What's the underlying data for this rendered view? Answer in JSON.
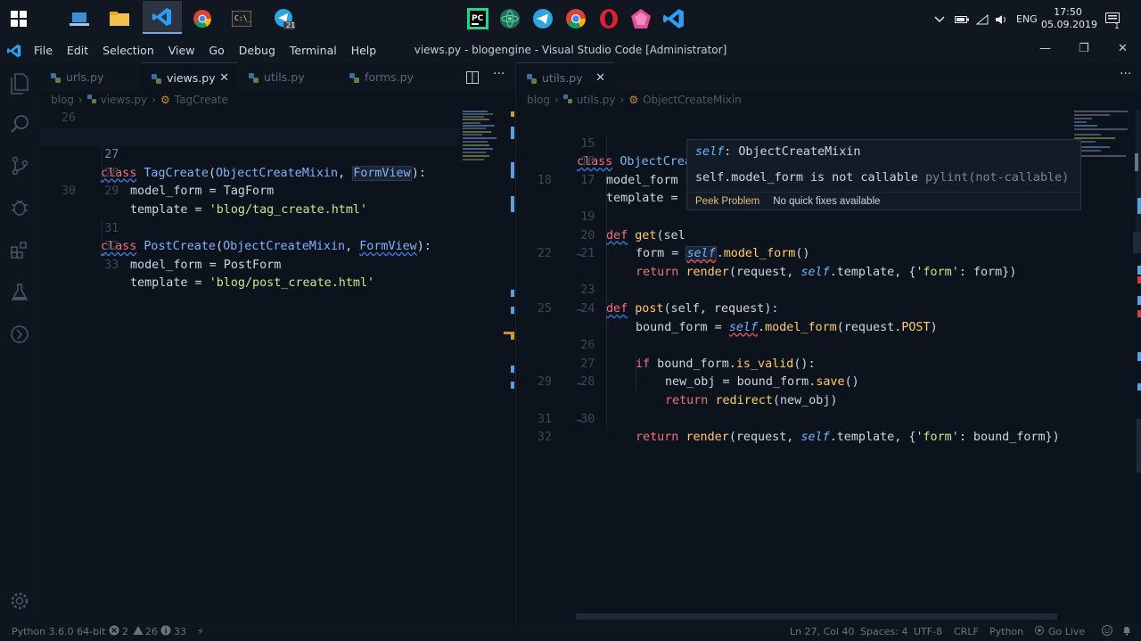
{
  "taskbar": {
    "lang": "ENG",
    "time": "17:50",
    "date": "05.09.2019",
    "telegram_badge": "21",
    "notif_badge": "1"
  },
  "window": {
    "title": "views.py - blogengine - Visual Studio Code [Administrator]",
    "menu": [
      "File",
      "Edit",
      "Selection",
      "View",
      "Go",
      "Debug",
      "Terminal",
      "Help"
    ]
  },
  "left_editor": {
    "tabs": [
      {
        "label": "urls.py",
        "active": false
      },
      {
        "label": "views.py",
        "active": true
      },
      {
        "label": "utils.py",
        "active": false
      },
      {
        "label": "forms.py",
        "active": false
      }
    ],
    "breadcrumb": [
      "blog",
      "views.py",
      "TagCreate"
    ],
    "lines": [
      {
        "n": "26"
      },
      {
        "n": "27"
      },
      {
        "n": "28"
      },
      {
        "n": "29"
      },
      {
        "n": "30"
      },
      {
        "n": "31"
      },
      {
        "n": "32"
      },
      {
        "n": "33"
      }
    ],
    "code": {
      "l27a": "class",
      "l27b": "TagCreate",
      "l27c": "(",
      "l27d": "ObjectCreateMixin",
      "l27e": ", ",
      "l27f": "FormView",
      "l27g": "):",
      "l28": "model_form = TagForm",
      "l29a": "template = ",
      "l29b": "'blog/tag_create.html'",
      "l31a": "class",
      "l31b": "PostCreate",
      "l31c": "(",
      "l31d": "ObjectCreateMixin",
      "l31e": ", ",
      "l31f": "FormView",
      "l31g": "):",
      "l32": "model_form = PostForm",
      "l33a": "template = ",
      "l33b": "'blog/post_create.html'"
    }
  },
  "right_editor": {
    "tabs": [
      {
        "label": "utils.py",
        "active": true
      }
    ],
    "breadcrumb": [
      "blog",
      "utils.py",
      "ObjectCreateMixin"
    ],
    "lines": [
      "15",
      "16",
      "17",
      "18",
      "19",
      "20",
      "21",
      "22",
      "23",
      "24",
      "25",
      "26",
      "27",
      "28",
      "29",
      "30",
      "31",
      "32"
    ],
    "code": {
      "l15a": "class",
      "l15b": "ObjectCreateMixin",
      "l15c": ":",
      "l16": "model_form",
      "l17": "template =",
      "l19a": "def",
      "l19b": "get",
      "l19c": "(sel",
      "l20a": "form = ",
      "l20b": "self",
      "l20c": ".",
      "l20d": "model_form",
      "l20e": "()",
      "l21a": "return",
      "l21b": "render",
      "l21c": "(request, ",
      "l21d": "self",
      "l21e": ".template, {",
      "l21f": "'form'",
      "l21g": ": form})",
      "l23a": "def",
      "l23b": "post",
      "l23c": "(self, request):",
      "l24a": "bound_form = ",
      "l24b": "self",
      "l24c": ".",
      "l24d": "model_form",
      "l24e": "(request.",
      "l24f": "POST",
      "l24g": ")",
      "l26a": "if",
      "l26b": " bound_form.",
      "l26c": "is_valid",
      "l26d": "():",
      "l27a": "new_obj = bound_form.",
      "l27b": "save",
      "l27c": "()",
      "l28a": "return",
      "l28b": "redirect",
      "l28c": "(new_obj)",
      "l30a": "return",
      "l30b": "render",
      "l30c": "(request, ",
      "l30d": "self",
      "l30e": ".template, {",
      "l30f": "'form'",
      "l30g": ": bound_form})"
    }
  },
  "hover": {
    "self_kw": "self",
    "type_text": ": ObjectCreateMixin",
    "message": "self.model_form is not callable",
    "source": "pylint(not-callable)",
    "peek": "Peek Problem",
    "no_fix": "No quick fixes available"
  },
  "statusbar": {
    "python": "Python 3.6.0 64-bit",
    "errors": "2",
    "warnings": "26",
    "infos": "33",
    "position": "Ln 27, Col 40",
    "spaces": "Spaces: 4",
    "encoding": "UTF-8",
    "eol": "CRLF",
    "language": "Python",
    "golive": "Go Live"
  }
}
